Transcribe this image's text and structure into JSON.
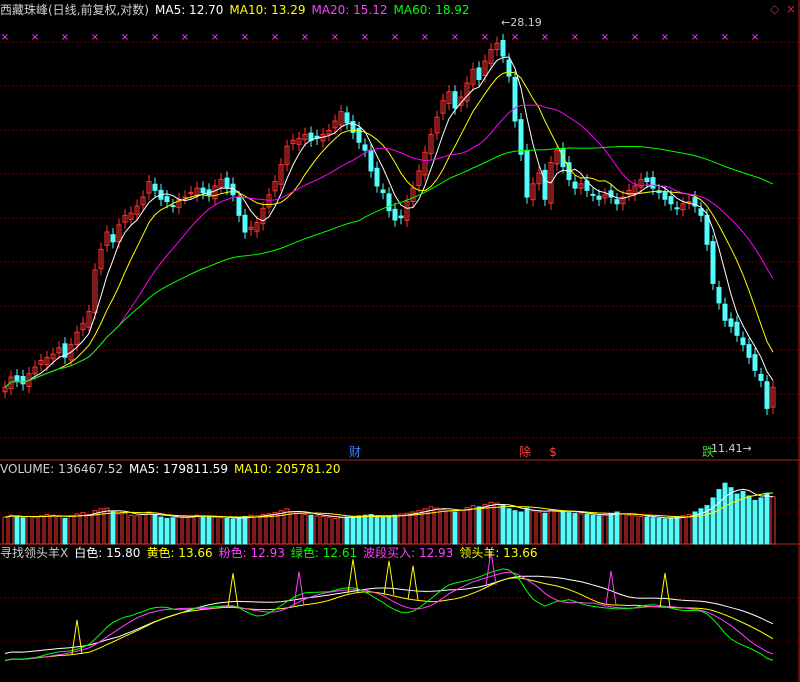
{
  "header": {
    "title": "西藏珠峰(日线,前复权,对数)",
    "ma5_label": "MA5: 12.70",
    "ma10_label": "MA10: 13.29",
    "ma20_label": "MA20: 15.12",
    "ma60_label": "MA60: 18.92"
  },
  "volume_header": {
    "label": "VOLUME: 136467.52",
    "ma5_label": "MA5: 179811.59",
    "ma10_label": "MA10: 205781.20"
  },
  "indicator_header": {
    "name": "寻找领头羊X",
    "white_label": "白色: 15.80",
    "yellow_label": "黄色: 13.66",
    "pink_label": "粉色: 12.93",
    "green_label": "绿色: 12.61",
    "wave_buy_label": "波段买入: 12.93",
    "leader_label": "领头羊: 13.66"
  },
  "window_controls": {
    "diamond": "◇",
    "close": "×"
  },
  "annotations": {
    "high_price": "28.19",
    "low_price": "11.41",
    "badges": [
      "财",
      "除",
      "$",
      "跌"
    ]
  },
  "colors": {
    "background": "#000000",
    "up_candle": "#ff3232",
    "down_candle": "#54fcfc",
    "ma5": "#ffffff",
    "ma10": "#ffff00",
    "ma20": "#ff00ff",
    "ma60": "#00ff00",
    "grid": "#8b0000",
    "marker": "#ff40ff"
  },
  "chart_data": [
    {
      "type": "candlestick",
      "title": "西藏珠峰(日线,前复权,对数)",
      "yscale": "log",
      "ylim": [
        11.0,
        29.5
      ],
      "series": [
        {
          "name": "MA5",
          "color": "#ffffff"
        },
        {
          "name": "MA10",
          "color": "#ffff00"
        },
        {
          "name": "MA20",
          "color": "#ff00ff"
        },
        {
          "name": "MA60",
          "color": "#00ff00"
        }
      ],
      "closes": [
        12.9,
        13.2,
        13.1,
        13.0,
        13.3,
        13.5,
        13.7,
        13.8,
        13.9,
        14.1,
        13.8,
        14.2,
        14.6,
        14.9,
        15.3,
        16.8,
        17.6,
        18.3,
        17.9,
        18.6,
        19.0,
        19.1,
        19.4,
        19.8,
        20.5,
        20.1,
        19.7,
        19.6,
        19.4,
        19.7,
        19.8,
        20.0,
        20.2,
        20.0,
        19.9,
        20.3,
        20.6,
        20.2,
        19.9,
        19.0,
        18.3,
        18.5,
        18.7,
        19.3,
        19.9,
        20.5,
        21.3,
        22.2,
        22.5,
        22.6,
        22.8,
        22.5,
        22.6,
        22.8,
        23.0,
        23.5,
        24.0,
        23.4,
        22.9,
        22.4,
        22.0,
        21.0,
        20.3,
        20.0,
        19.2,
        18.8,
        18.9,
        19.6,
        20.2,
        21.0,
        21.9,
        22.8,
        23.7,
        24.6,
        25.1,
        24.2,
        24.8,
        25.6,
        26.4,
        25.8,
        26.9,
        27.6,
        28.0,
        27.2,
        26.0,
        23.5,
        21.8,
        19.8,
        20.4,
        20.9,
        19.7,
        21.4,
        22.0,
        21.2,
        20.6,
        20.2,
        20.4,
        20.1,
        19.9,
        19.7,
        19.9,
        19.8,
        19.5,
        19.8,
        20.1,
        20.3,
        20.6,
        20.5,
        20.2,
        20.0,
        19.7,
        19.5,
        19.3,
        19.5,
        19.6,
        19.4,
        19.0,
        17.8,
        16.3,
        15.6,
        15.0,
        14.8,
        14.5,
        14.2,
        13.8,
        13.4,
        13.1,
        12.3,
        12.9
      ],
      "volumes": [
        0.42,
        0.45,
        0.44,
        0.41,
        0.43,
        0.42,
        0.44,
        0.46,
        0.45,
        0.43,
        0.4,
        0.44,
        0.47,
        0.49,
        0.46,
        0.52,
        0.55,
        0.56,
        0.5,
        0.47,
        0.48,
        0.45,
        0.44,
        0.46,
        0.5,
        0.46,
        0.42,
        0.4,
        0.41,
        0.42,
        0.44,
        0.43,
        0.45,
        0.44,
        0.43,
        0.42,
        0.41,
        0.4,
        0.39,
        0.41,
        0.43,
        0.45,
        0.44,
        0.46,
        0.47,
        0.49,
        0.52,
        0.55,
        0.5,
        0.48,
        0.46,
        0.45,
        0.44,
        0.43,
        0.42,
        0.4,
        0.41,
        0.42,
        0.43,
        0.44,
        0.45,
        0.46,
        0.43,
        0.42,
        0.44,
        0.45,
        0.47,
        0.48,
        0.5,
        0.52,
        0.55,
        0.58,
        0.56,
        0.54,
        0.52,
        0.5,
        0.53,
        0.57,
        0.6,
        0.58,
        0.62,
        0.65,
        0.64,
        0.6,
        0.55,
        0.52,
        0.5,
        0.56,
        0.52,
        0.5,
        0.48,
        0.54,
        0.53,
        0.51,
        0.49,
        0.48,
        0.47,
        0.46,
        0.45,
        0.44,
        0.46,
        0.48,
        0.5,
        0.47,
        0.45,
        0.44,
        0.43,
        0.42,
        0.41,
        0.4,
        0.39,
        0.41,
        0.43,
        0.44,
        0.46,
        0.5,
        0.55,
        0.6,
        0.72,
        0.85,
        0.95,
        0.88,
        0.78,
        0.82,
        0.75,
        0.68,
        0.72,
        0.79,
        0.74
      ]
    },
    {
      "type": "bar",
      "title": "VOLUME: 136467.52",
      "series": [
        {
          "name": "MA5",
          "color": "#ffffff"
        },
        {
          "name": "MA10",
          "color": "#ffff00"
        }
      ]
    },
    {
      "type": "line",
      "title": "寻找领头羊X",
      "series": [
        {
          "name": "白色",
          "color": "#ffffff"
        },
        {
          "name": "黄色",
          "color": "#ffff00"
        },
        {
          "name": "粉色",
          "color": "#ff40ff"
        },
        {
          "name": "绿色",
          "color": "#00ff00"
        }
      ]
    }
  ]
}
